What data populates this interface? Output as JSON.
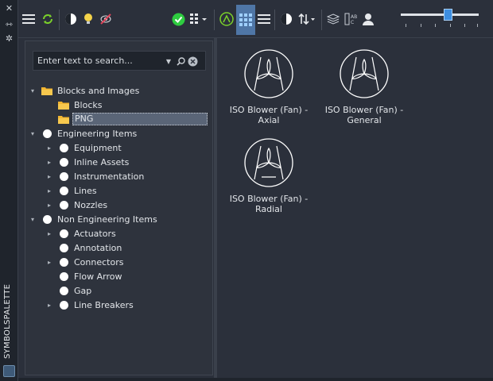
{
  "palette": {
    "title": "SYMBOLSPALETTE"
  },
  "toolbar": {
    "buttons": [
      {
        "name": "menu-icon"
      },
      {
        "name": "refresh-icon"
      },
      {
        "name": "contrast-icon"
      },
      {
        "name": "lightbulb-icon"
      },
      {
        "name": "no-view-icon"
      },
      {
        "name": "check-icon"
      },
      {
        "name": "grid-view-icon"
      },
      {
        "name": "shape-icon"
      },
      {
        "name": "tile-view-icon"
      },
      {
        "name": "list-view-icon"
      },
      {
        "name": "contrast-icon-2"
      },
      {
        "name": "sort-icon"
      },
      {
        "name": "layers-icon"
      },
      {
        "name": "text-label-icon"
      },
      {
        "name": "user-icon"
      }
    ],
    "slider": {
      "value_fraction": 0.6
    }
  },
  "search": {
    "placeholder": "Enter text to search..."
  },
  "tree": [
    {
      "label": "Blocks and Images",
      "level": 0,
      "expanded": true,
      "icon": "folder-icon"
    },
    {
      "label": "Blocks",
      "level": 1,
      "icon": "folder-icon"
    },
    {
      "label": "PNG",
      "level": 1,
      "icon": "folder-icon",
      "selected": true
    },
    {
      "label": "Engineering Items",
      "level": 0,
      "expanded": true,
      "icon": "dot-icon"
    },
    {
      "label": "Equipment",
      "level": 1,
      "expandable": true,
      "icon": "dot-icon"
    },
    {
      "label": "Inline Assets",
      "level": 1,
      "expandable": true,
      "icon": "dot-icon"
    },
    {
      "label": "Instrumentation",
      "level": 1,
      "expandable": true,
      "icon": "dot-icon"
    },
    {
      "label": "Lines",
      "level": 1,
      "expandable": true,
      "icon": "dot-icon"
    },
    {
      "label": "Nozzles",
      "level": 1,
      "expandable": true,
      "icon": "dot-icon"
    },
    {
      "label": "Non Engineering Items",
      "level": 0,
      "expanded": true,
      "icon": "dot-icon"
    },
    {
      "label": "Actuators",
      "level": 1,
      "expandable": true,
      "icon": "dot-icon"
    },
    {
      "label": "Annotation",
      "level": 1,
      "icon": "dot-icon"
    },
    {
      "label": "Connectors",
      "level": 1,
      "expandable": true,
      "icon": "dot-icon"
    },
    {
      "label": "Flow Arrow",
      "level": 1,
      "icon": "dot-icon"
    },
    {
      "label": "Gap",
      "level": 1,
      "icon": "dot-icon"
    },
    {
      "label": "Line Breakers",
      "level": 1,
      "expandable": true,
      "icon": "dot-icon"
    }
  ],
  "symbols": [
    {
      "caption": "ISO Blower (Fan) - Axial",
      "line1": "ISO Blower (Fan) -",
      "line2": "Axial",
      "variant": "axial"
    },
    {
      "caption": "ISO Blower (Fan) - General",
      "line1": "ISO Blower (Fan) -",
      "line2": "General",
      "variant": "general"
    },
    {
      "caption": "ISO Blower (Fan) - Radial",
      "line1": "ISO Blower (Fan) -",
      "line2": "Radial",
      "variant": "radial"
    }
  ],
  "colors": {
    "background": "#2b303b",
    "panel": "#2e333d",
    "accent": "#4f76a6",
    "check": "#2ecc40",
    "folder": "#f2b530"
  }
}
